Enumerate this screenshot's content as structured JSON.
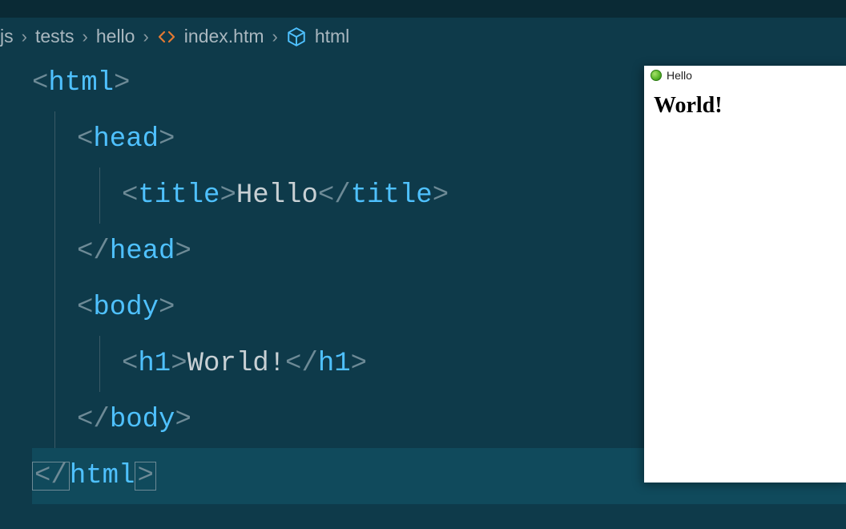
{
  "breadcrumb": {
    "segments": [
      "js",
      "tests",
      "hello",
      "index.htm",
      "html"
    ]
  },
  "code": {
    "lines": [
      {
        "open": "<",
        "tag": "html",
        "close": ">",
        "indent": 0
      },
      {
        "open": "<",
        "tag": "head",
        "close": ">",
        "indent": 1
      },
      {
        "open": "<",
        "tag": "title",
        "close": ">",
        "text": "Hello",
        "endopen": "</",
        "endtag": "title",
        "endclose": ">",
        "indent": 2
      },
      {
        "open": "</",
        "tag": "head",
        "close": ">",
        "indent": 1
      },
      {
        "open": "<",
        "tag": "body",
        "close": ">",
        "indent": 1
      },
      {
        "open": "<",
        "tag": "h1",
        "close": ">",
        "text": "World!",
        "endopen": "</",
        "endtag": "h1",
        "endclose": ">",
        "indent": 2
      },
      {
        "open": "</",
        "tag": "body",
        "close": ">",
        "indent": 1
      },
      {
        "open": "</",
        "tag": "html",
        "close": ">",
        "indent": 0,
        "current": true,
        "bracket_match": true
      }
    ]
  },
  "preview": {
    "title": "Hello",
    "h1": "World!"
  }
}
